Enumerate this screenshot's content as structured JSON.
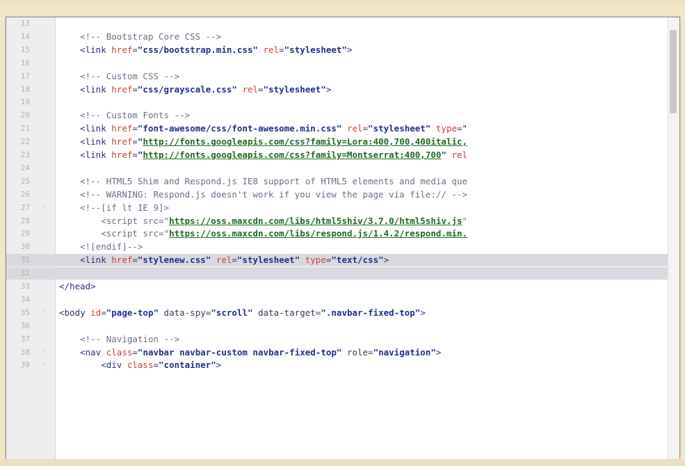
{
  "editor": {
    "lines": [
      {
        "num": "13",
        "fold": "",
        "indent": "",
        "segs": []
      },
      {
        "num": "14",
        "fold": "",
        "indent": "    ",
        "segs": [
          {
            "t": "<!-- Bootstrap Core CSS -->",
            "c": "com"
          }
        ]
      },
      {
        "num": "15",
        "fold": "",
        "indent": "    ",
        "segs": [
          {
            "t": "<link ",
            "c": "tag"
          },
          {
            "t": "href",
            "c": "attr"
          },
          {
            "t": "=",
            "c": "plain"
          },
          {
            "t": "\"css/bootstrap.min.css\"",
            "c": "str"
          },
          {
            "t": " ",
            "c": "plain"
          },
          {
            "t": "rel",
            "c": "attr"
          },
          {
            "t": "=",
            "c": "plain"
          },
          {
            "t": "\"stylesheet\"",
            "c": "str"
          },
          {
            "t": ">",
            "c": "tag"
          }
        ]
      },
      {
        "num": "16",
        "fold": "",
        "indent": "",
        "segs": []
      },
      {
        "num": "17",
        "fold": "",
        "indent": "    ",
        "segs": [
          {
            "t": "<!-- Custom CSS -->",
            "c": "com"
          }
        ]
      },
      {
        "num": "18",
        "fold": "",
        "indent": "    ",
        "segs": [
          {
            "t": "<link ",
            "c": "tag"
          },
          {
            "t": "href",
            "c": "attr"
          },
          {
            "t": "=",
            "c": "plain"
          },
          {
            "t": "\"css/grayscale.css\"",
            "c": "str"
          },
          {
            "t": " ",
            "c": "plain"
          },
          {
            "t": "rel",
            "c": "attr"
          },
          {
            "t": "=",
            "c": "plain"
          },
          {
            "t": "\"stylesheet\"",
            "c": "str"
          },
          {
            "t": ">",
            "c": "tag"
          }
        ]
      },
      {
        "num": "19",
        "fold": "",
        "indent": "",
        "segs": []
      },
      {
        "num": "20",
        "fold": "",
        "indent": "    ",
        "segs": [
          {
            "t": "<!-- Custom Fonts -->",
            "c": "com"
          }
        ]
      },
      {
        "num": "21",
        "fold": "",
        "indent": "    ",
        "segs": [
          {
            "t": "<link ",
            "c": "tag"
          },
          {
            "t": "href",
            "c": "attr"
          },
          {
            "t": "=",
            "c": "plain"
          },
          {
            "t": "\"font-awesome/css/font-awesome.min.css\"",
            "c": "str"
          },
          {
            "t": " ",
            "c": "plain"
          },
          {
            "t": "rel",
            "c": "attr"
          },
          {
            "t": "=",
            "c": "plain"
          },
          {
            "t": "\"stylesheet\"",
            "c": "str"
          },
          {
            "t": " ",
            "c": "plain"
          },
          {
            "t": "type",
            "c": "attr"
          },
          {
            "t": "=\"",
            "c": "plain"
          }
        ]
      },
      {
        "num": "22",
        "fold": "",
        "indent": "    ",
        "segs": [
          {
            "t": "<link ",
            "c": "tag"
          },
          {
            "t": "href",
            "c": "attr"
          },
          {
            "t": "=",
            "c": "plain"
          },
          {
            "t": "\"",
            "c": "str"
          },
          {
            "t": "http://fonts.googleapis.com/css?family=Lora:400,700,400italic,",
            "c": "url"
          }
        ]
      },
      {
        "num": "23",
        "fold": "",
        "indent": "    ",
        "segs": [
          {
            "t": "<link ",
            "c": "tag"
          },
          {
            "t": "href",
            "c": "attr"
          },
          {
            "t": "=",
            "c": "plain"
          },
          {
            "t": "\"",
            "c": "str"
          },
          {
            "t": "http://fonts.googleapis.com/css?family=Montserrat:400,700",
            "c": "url"
          },
          {
            "t": "\"",
            "c": "str"
          },
          {
            "t": " ",
            "c": "plain"
          },
          {
            "t": "rel",
            "c": "attr"
          }
        ]
      },
      {
        "num": "24",
        "fold": "",
        "indent": "",
        "segs": []
      },
      {
        "num": "25",
        "fold": "",
        "indent": "    ",
        "segs": [
          {
            "t": "<!-- HTML5 Shim and Respond.js IE8 support of HTML5 elements and media que",
            "c": "com"
          }
        ]
      },
      {
        "num": "26",
        "fold": "",
        "indent": "    ",
        "segs": [
          {
            "t": "<!-- WARNING: Respond.js doesn't work if you view the page via file:// -->",
            "c": "com"
          }
        ]
      },
      {
        "num": "27",
        "fold": "◦",
        "indent": "    ",
        "segs": [
          {
            "t": "<!--[if lt IE 9]>",
            "c": "com"
          }
        ]
      },
      {
        "num": "28",
        "fold": "",
        "indent": "        ",
        "segs": [
          {
            "t": "<script ",
            "c": "com"
          },
          {
            "t": "src=\"",
            "c": "com"
          },
          {
            "t": "https://oss.maxcdn.com/libs/html5shiv/3.7.0/html5shiv.js",
            "c": "url"
          },
          {
            "t": "\"",
            "c": "com"
          }
        ]
      },
      {
        "num": "29",
        "fold": "",
        "indent": "        ",
        "segs": [
          {
            "t": "<script ",
            "c": "com"
          },
          {
            "t": "src=\"",
            "c": "com"
          },
          {
            "t": "https://oss.maxcdn.com/libs/respond.js/1.4.2/respond.min.",
            "c": "url"
          }
        ]
      },
      {
        "num": "30",
        "fold": "",
        "indent": "    ",
        "segs": [
          {
            "t": "<![endif]-->",
            "c": "com"
          }
        ]
      },
      {
        "num": "31",
        "fold": "",
        "indent": "    ",
        "hl": true,
        "segs": [
          {
            "t": "<link ",
            "c": "tag"
          },
          {
            "t": "href",
            "c": "attr"
          },
          {
            "t": "=",
            "c": "plain"
          },
          {
            "t": "\"stylenew.css\"",
            "c": "str"
          },
          {
            "t": " ",
            "c": "plain"
          },
          {
            "t": "rel",
            "c": "attr"
          },
          {
            "t": "=",
            "c": "plain"
          },
          {
            "t": "\"stylesheet\"",
            "c": "str"
          },
          {
            "t": " ",
            "c": "plain"
          },
          {
            "t": "type",
            "c": "attr"
          },
          {
            "t": "=",
            "c": "plain"
          },
          {
            "t": "\"text/css\"",
            "c": "str"
          },
          {
            "t": ">",
            "c": "tag"
          }
        ]
      },
      {
        "num": "32",
        "fold": "",
        "indent": "",
        "hl": true,
        "segs": []
      },
      {
        "num": "33",
        "fold": "",
        "indent": "",
        "segs": [
          {
            "t": "</head>",
            "c": "tag"
          }
        ]
      },
      {
        "num": "34",
        "fold": "",
        "indent": "",
        "segs": []
      },
      {
        "num": "35",
        "fold": "◦",
        "indent": "",
        "segs": [
          {
            "t": "<body ",
            "c": "tag"
          },
          {
            "t": "id",
            "c": "attr"
          },
          {
            "t": "=",
            "c": "plain"
          },
          {
            "t": "\"page-top\"",
            "c": "str"
          },
          {
            "t": " data-spy=",
            "c": "plain"
          },
          {
            "t": "\"scroll\"",
            "c": "str"
          },
          {
            "t": " data-target=",
            "c": "plain"
          },
          {
            "t": "\".navbar-fixed-top\"",
            "c": "str"
          },
          {
            "t": ">",
            "c": "tag"
          }
        ]
      },
      {
        "num": "36",
        "fold": "",
        "indent": "",
        "segs": []
      },
      {
        "num": "37",
        "fold": "",
        "indent": "    ",
        "segs": [
          {
            "t": "<!-- Navigation -->",
            "c": "com"
          }
        ]
      },
      {
        "num": "38",
        "fold": "◦",
        "indent": "    ",
        "segs": [
          {
            "t": "<nav ",
            "c": "tag"
          },
          {
            "t": "class",
            "c": "attr"
          },
          {
            "t": "=",
            "c": "plain"
          },
          {
            "t": "\"navbar navbar-custom navbar-fixed-top\"",
            "c": "str"
          },
          {
            "t": " role=",
            "c": "plain"
          },
          {
            "t": "\"navigation\"",
            "c": "str"
          },
          {
            "t": ">",
            "c": "tag"
          }
        ]
      },
      {
        "num": "39",
        "fold": "◦",
        "indent": "        ",
        "segs": [
          {
            "t": "<div ",
            "c": "tag"
          },
          {
            "t": "class",
            "c": "attr"
          },
          {
            "t": "=",
            "c": "plain"
          },
          {
            "t": "\"container\"",
            "c": "str"
          },
          {
            "t": ">",
            "c": "tag"
          }
        ]
      }
    ]
  }
}
